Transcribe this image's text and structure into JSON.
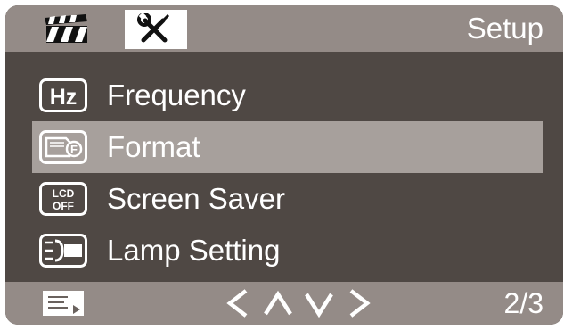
{
  "header": {
    "title": "Setup",
    "tabs": [
      {
        "icon": "movie-clapperboard-icon"
      },
      {
        "icon": "wrench-screwdriver-icon",
        "selected": true
      }
    ]
  },
  "menu": {
    "items": [
      {
        "label": "Frequency",
        "icon": "hz-icon",
        "icon_text": "Hz",
        "selected": false
      },
      {
        "label": "Format",
        "icon": "format-sd-card-icon",
        "selected": true
      },
      {
        "label": "Screen Saver",
        "icon": "lcd-off-icon",
        "icon_text_line1": "LCD",
        "icon_text_line2": "OFF",
        "selected": false
      },
      {
        "label": "Lamp Setting",
        "icon": "lamp-headlight-icon",
        "selected": false
      }
    ]
  },
  "footer": {
    "left_icon": "menu-list-icon",
    "nav": [
      "left-arrow-icon",
      "up-arrow-icon",
      "down-arrow-icon",
      "right-arrow-icon"
    ],
    "page": "2/3"
  },
  "colors": {
    "screen_bg": "#4f4844",
    "bar_bg": "#948b87",
    "selection_bg": "#a7a09c",
    "text": "#ffffff"
  }
}
